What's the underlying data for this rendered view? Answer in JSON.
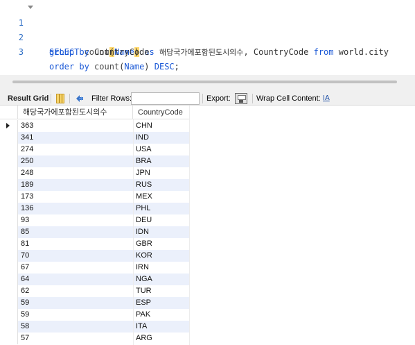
{
  "editor": {
    "lines": [
      {
        "num": "1",
        "parts": [
          {
            "t": "SELECT ",
            "c": "kw"
          },
          {
            "t": "count",
            "c": "fn"
          },
          {
            "t": "(",
            "c": "tx hl"
          },
          {
            "t": "Name",
            "c": "kw"
          },
          {
            "t": ")",
            "c": "tx hl"
          },
          {
            "t": " as ",
            "c": "kw"
          },
          {
            "t": "해당국가에포함된도시의수",
            "c": "tx kr"
          },
          {
            "t": ", CountryCode ",
            "c": "tx"
          },
          {
            "t": "from ",
            "c": "kw"
          },
          {
            "t": "world.city",
            "c": "tx"
          }
        ]
      },
      {
        "num": "2",
        "parts": [
          {
            "t": "group by ",
            "c": "kw"
          },
          {
            "t": "CountryCode",
            "c": "tx"
          }
        ]
      },
      {
        "num": "3",
        "parts": [
          {
            "t": "order by ",
            "c": "kw"
          },
          {
            "t": "count",
            "c": "fn"
          },
          {
            "t": "(",
            "c": "tx"
          },
          {
            "t": "Name",
            "c": "kw"
          },
          {
            "t": ") ",
            "c": "tx"
          },
          {
            "t": "DESC",
            "c": "kw"
          },
          {
            "t": ";",
            "c": "tx"
          }
        ]
      }
    ]
  },
  "toolbar": {
    "result_grid_label": "Result Grid",
    "filter_rows_label": "Filter Rows:",
    "filter_value": "",
    "export_label": "Export:",
    "wrap_cell_label": "Wrap Cell Content:",
    "wrap_icon_glyph": "IA"
  },
  "grid": {
    "columns": [
      "해당국가에포함된도시의수",
      "CountryCode"
    ],
    "rows": [
      [
        "363",
        "CHN"
      ],
      [
        "341",
        "IND"
      ],
      [
        "274",
        "USA"
      ],
      [
        "250",
        "BRA"
      ],
      [
        "248",
        "JPN"
      ],
      [
        "189",
        "RUS"
      ],
      [
        "173",
        "MEX"
      ],
      [
        "136",
        "PHL"
      ],
      [
        "93",
        "DEU"
      ],
      [
        "85",
        "IDN"
      ],
      [
        "81",
        "GBR"
      ],
      [
        "70",
        "KOR"
      ],
      [
        "67",
        "IRN"
      ],
      [
        "64",
        "NGA"
      ],
      [
        "62",
        "TUR"
      ],
      [
        "59",
        "ESP"
      ],
      [
        "59",
        "PAK"
      ],
      [
        "58",
        "ITA"
      ],
      [
        "57",
        "ARG"
      ]
    ]
  }
}
